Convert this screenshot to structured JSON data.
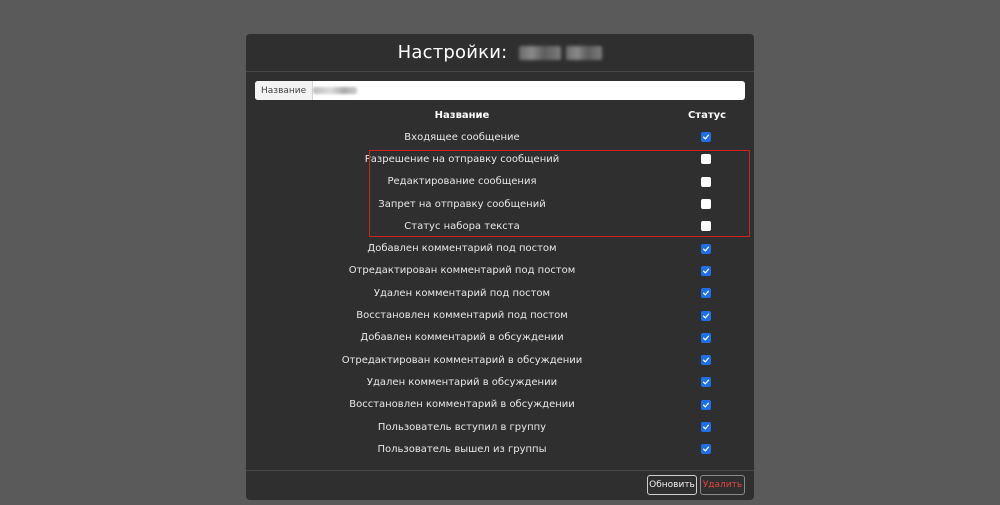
{
  "modal": {
    "title": "Настройки:",
    "field": {
      "label": "Название",
      "value": ""
    },
    "columns": {
      "name": "Название",
      "status": "Статус"
    },
    "rows": [
      {
        "label": "Входящее сообщение",
        "checked": true
      },
      {
        "label": "Разрешение на отправку сообщений",
        "checked": false
      },
      {
        "label": "Редактирование сообщения",
        "checked": false
      },
      {
        "label": "Запрет на отправку сообщений",
        "checked": false
      },
      {
        "label": "Статус набора текста",
        "checked": false
      },
      {
        "label": "Добавлен комментарий под постом",
        "checked": true
      },
      {
        "label": "Отредактирован комментарий под постом",
        "checked": true
      },
      {
        "label": "Удален комментарий под постом",
        "checked": true
      },
      {
        "label": "Восстановлен комментарий под постом",
        "checked": true
      },
      {
        "label": "Добавлен комментарий в обсуждении",
        "checked": true
      },
      {
        "label": "Отредактирован комментарий в обсуждении",
        "checked": true
      },
      {
        "label": "Удален комментарий в обсуждении",
        "checked": true
      },
      {
        "label": "Восстановлен комментарий в обсуждении",
        "checked": true
      },
      {
        "label": "Пользователь вступил в группу",
        "checked": true
      },
      {
        "label": "Пользователь вышел из группы",
        "checked": true
      }
    ],
    "buttons": {
      "refresh": "Обновить",
      "delete": "Удалить"
    }
  },
  "colors": {
    "backdrop": "#5a5a5a",
    "panel": "#2f2f2f",
    "checkbox_on": "#1f6fe8",
    "highlight": "#d41f1f",
    "delete_text": "#e0463e"
  }
}
